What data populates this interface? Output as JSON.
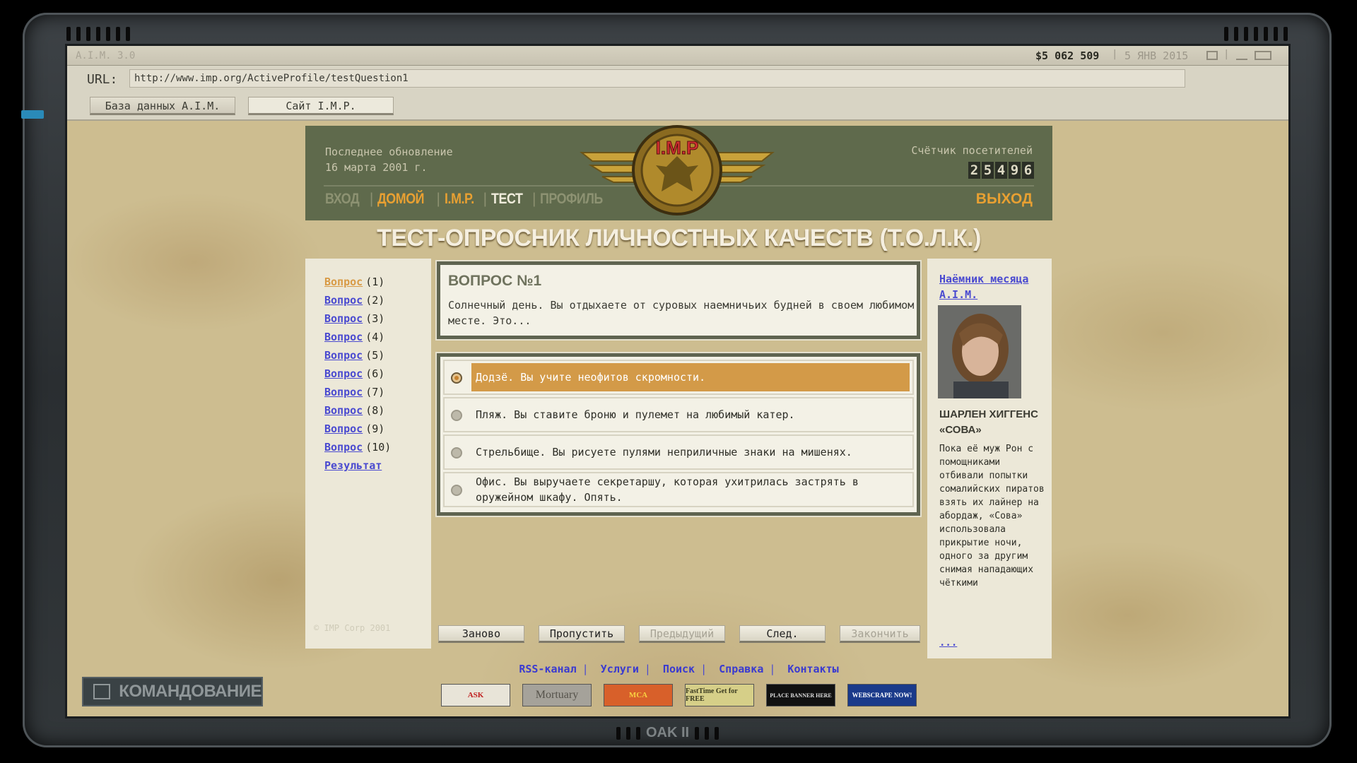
{
  "topbar": {
    "version": "A.I.M. 3.0",
    "money": "$5 062 509",
    "date": "5 ЯНВ 2015"
  },
  "url": {
    "label": "URL:",
    "value": "http://www.imp.org/ActiveProfile/testQuestion1"
  },
  "tabs": [
    "База данных A.I.M.",
    "Сайт I.M.P."
  ],
  "header": {
    "updated": "Последнее обновление\n16 марта 2001 г.",
    "counter_label": "Счётчик посетителей",
    "counter_digits": [
      "2",
      "5",
      "4",
      "9",
      "6"
    ],
    "logo_text": "I.M.P",
    "nav": [
      "ВХОД",
      "ДОМОЙ",
      "I.M.P.",
      "ТЕСТ",
      "ПРОФИЛЬ"
    ],
    "logout": "ВЫХОД"
  },
  "page_title": "ТЕСТ-ОПРОСНИК ЛИЧНОСТНЫХ КАЧЕСТВ (Т.О.Л.К.)",
  "sidebar": {
    "question_link": "Вопрос",
    "items": [
      "(1)",
      "(2)",
      "(3)",
      "(4)",
      "(5)",
      "(6)",
      "(7)",
      "(8)",
      "(9)",
      "(10)"
    ],
    "result": "Результат",
    "copyright": "© IMP Corp 2001"
  },
  "question": {
    "heading": "ВОПРОС №1",
    "text": "Солнечный день. Вы отдыхаете от суровых наемничьих будней в своем любимом месте. Это..."
  },
  "answers": [
    "Додзё. Вы учите неофитов скромности.",
    "Пляж. Вы ставите броню и пулемет на любимый катер.",
    "Стрельбище. Вы рисуете пулями неприличные знаки на мишенях.",
    "Офис. Вы выручаете секретаршу, которая ухитрилась застрять в оружейном шкафу. Опять."
  ],
  "buttons": {
    "restart": "Заново",
    "skip": "Пропустить",
    "prev": "Предыдущий",
    "next": "След.",
    "finish": "Закончить"
  },
  "merc": {
    "link": "Наёмник месяца A.I.M.",
    "name": "ШАРЛЕН ХИГГЕНС «СОВА»",
    "bio": "Пока её муж Рон с помощниками отбивали попытки сомалийских пиратов взять их лайнер на абордаж, «Сова» использовала прикрытие ночи, одного за другим снимая нападающих чёткими",
    "more": "..."
  },
  "footer_links": [
    "RSS-канал",
    "Услуги",
    "Поиск",
    "Справка",
    "Контакты"
  ],
  "banners": [
    "ASK",
    "Mortuary",
    "MCA",
    "FastTime Get for FREE",
    "PLACE BANNER HERE",
    "WEBSCRAPE NOW!"
  ],
  "command": "КОМАНДОВАНИЕ",
  "brand": "OAK II"
}
